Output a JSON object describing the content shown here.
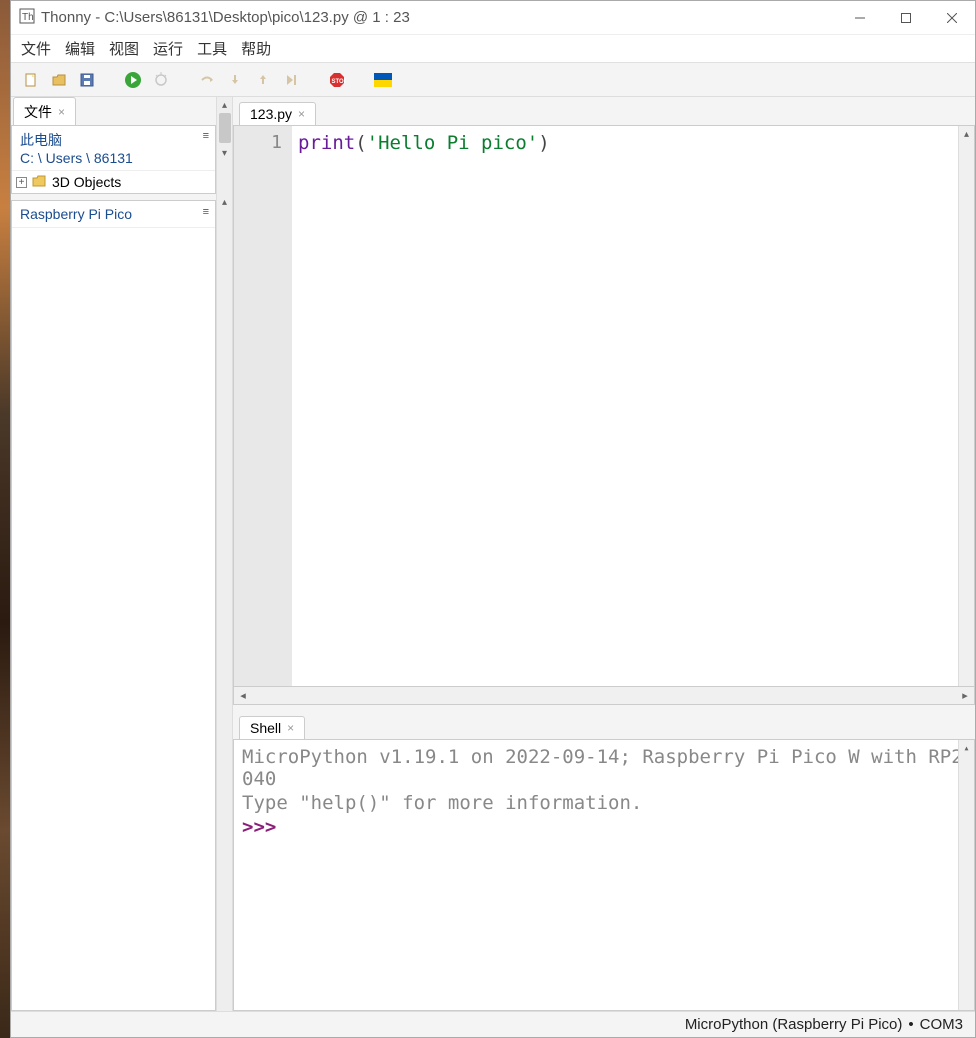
{
  "titlebar": {
    "app_name": "Thonny",
    "separator": " - ",
    "file_path": "C:\\Users\\86131\\Desktop\\pico\\123.py",
    "cursor": " @ 1 : 23"
  },
  "menu": {
    "file": "文件",
    "edit": "编辑",
    "view": "视图",
    "run": "运行",
    "tools": "工具",
    "help": "帮助"
  },
  "sidebar": {
    "files_tab": "文件",
    "this_pc": "此电脑",
    "path": "C: \\ Users \\ 86131",
    "item_3d": "3D Objects",
    "device": "Raspberry Pi Pico"
  },
  "editor": {
    "tab_name": "123.py",
    "line_no": "1",
    "code_fn": "print",
    "code_lparen": "(",
    "code_str": "'Hello Pi pico'",
    "code_rparen": ")"
  },
  "shell": {
    "tab_name": "Shell",
    "line1": "MicroPython v1.19.1 on 2022-09-14; Raspberry Pi Pico W with RP2040",
    "line2": "Type \"help()\" for more information.",
    "prompt": ">>> "
  },
  "statusbar": {
    "interpreter": "MicroPython (Raspberry Pi Pico)",
    "port": "COM3"
  }
}
